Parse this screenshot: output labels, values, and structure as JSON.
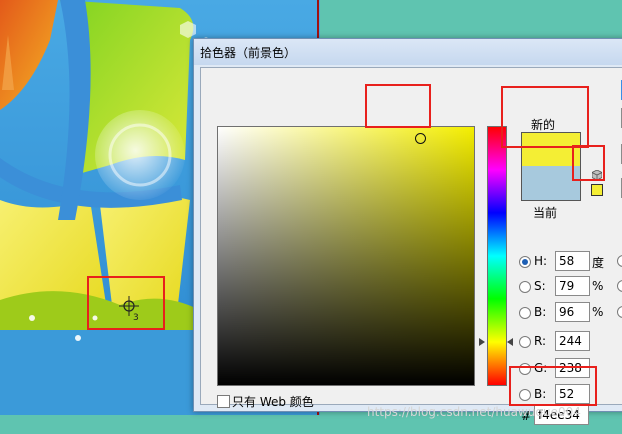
{
  "dialog": {
    "title": "拾色器（前景色）",
    "new_label": "新的",
    "current_label": "当前",
    "new_color": "#f4ee34",
    "current_color": "#a7c9dd",
    "web_only_label": "只有 Web 颜色",
    "web_only_checked": false,
    "fields": [
      {
        "key": "H",
        "label": "H:",
        "value": "58",
        "unit": "度",
        "selected": true
      },
      {
        "key": "S",
        "label": "S:",
        "value": "79",
        "unit": "%",
        "selected": false
      },
      {
        "key": "Bv",
        "label": "B:",
        "value": "96",
        "unit": "%",
        "selected": false
      },
      {
        "key": "R",
        "label": "R:",
        "value": "244",
        "unit": "",
        "selected": false
      },
      {
        "key": "G",
        "label": "G:",
        "value": "238",
        "unit": "",
        "selected": false
      },
      {
        "key": "Bl",
        "label": "B:",
        "value": "52",
        "unit": "",
        "selected": false
      }
    ],
    "hex_symbol": "#",
    "hex_value": "f4ee34",
    "hue_field_color": "#f4ee00"
  },
  "desktop": {
    "sampler_tool_number": "3"
  },
  "annotation_color": "#e8201c",
  "watermark": "https://blog.csdn.net/huawuque004"
}
